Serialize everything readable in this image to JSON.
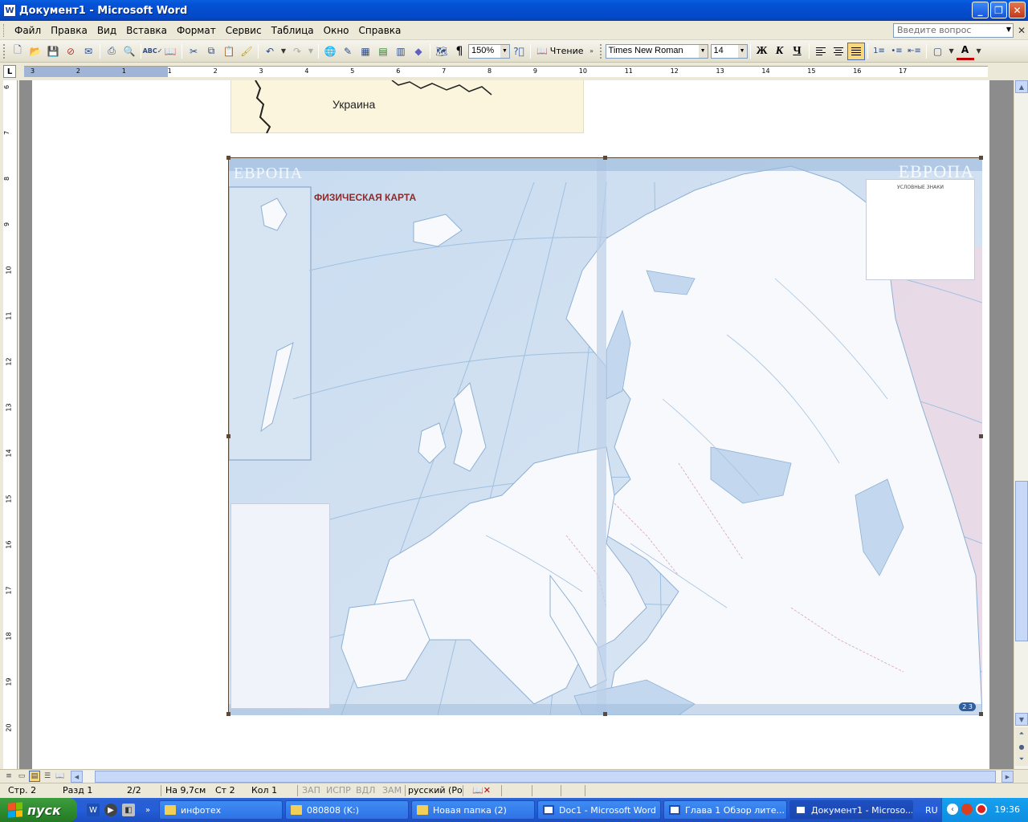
{
  "window": {
    "title": "Документ1 - Microsoft Word",
    "app_icon": "W",
    "controls": [
      "minimize-icon",
      "restore-icon",
      "close-icon"
    ]
  },
  "menubar": {
    "items": [
      "Файл",
      "Правка",
      "Вид",
      "Вставка",
      "Формат",
      "Сервис",
      "Таблица",
      "Окно",
      "Справка"
    ],
    "ask_placeholder": "Введите вопрос"
  },
  "toolbar": {
    "zoom": "150%",
    "reading_label": "Чтение",
    "font_name": "Times New Roman",
    "font_size": "14",
    "bold": "Ж",
    "italic": "К",
    "underline": "Ч",
    "paragraph_mark": "¶",
    "highlight_letter": "A"
  },
  "ruler": {
    "corner": "L",
    "ticks": [
      "3",
      "2",
      "1",
      "1",
      "2",
      "3",
      "4",
      "5",
      "6",
      "7",
      "8",
      "9",
      "10",
      "11",
      "12",
      "13",
      "14",
      "15",
      "16",
      "17"
    ],
    "vticks": [
      "6",
      "7",
      "8",
      "9",
      "10",
      "11",
      "12",
      "13",
      "14",
      "15",
      "16",
      "17",
      "18",
      "19",
      "20"
    ]
  },
  "document": {
    "snippet_label": "Украина",
    "map_title_left": "ЕВРОПА",
    "map_title_right": "ЕВРОПА",
    "map_heading": "ФИЗИЧЕСКАЯ КАРТА",
    "legend_title": "УСЛОВНЫЕ ЗНАКИ",
    "page_badge": "2 3"
  },
  "statusbar": {
    "page": "Стр. 2",
    "section": "Разд 1",
    "pages": "2/2",
    "position": "На 9,7см",
    "line": "Ст 2",
    "column": "Кол 1",
    "rec": "ЗАП",
    "trk": "ИСПР",
    "ext": "ВДЛ",
    "ovr": "ЗАМ",
    "language": "русский (Ро"
  },
  "taskbar": {
    "start_label": "пуск",
    "tasks": [
      {
        "label": "инфотех",
        "icon": "folder-icon"
      },
      {
        "label": "080808 (K:)",
        "icon": "folder-icon"
      },
      {
        "label": "Новая папка (2)",
        "icon": "folder-icon"
      },
      {
        "label": "Doc1 - Microsoft Word",
        "icon": "word-icon"
      },
      {
        "label": "Глава 1 Обзор лите...",
        "icon": "word-icon"
      },
      {
        "label": "Документ1 - Microso...",
        "icon": "word-icon"
      }
    ],
    "lang": "RU",
    "clock": "19:36"
  }
}
